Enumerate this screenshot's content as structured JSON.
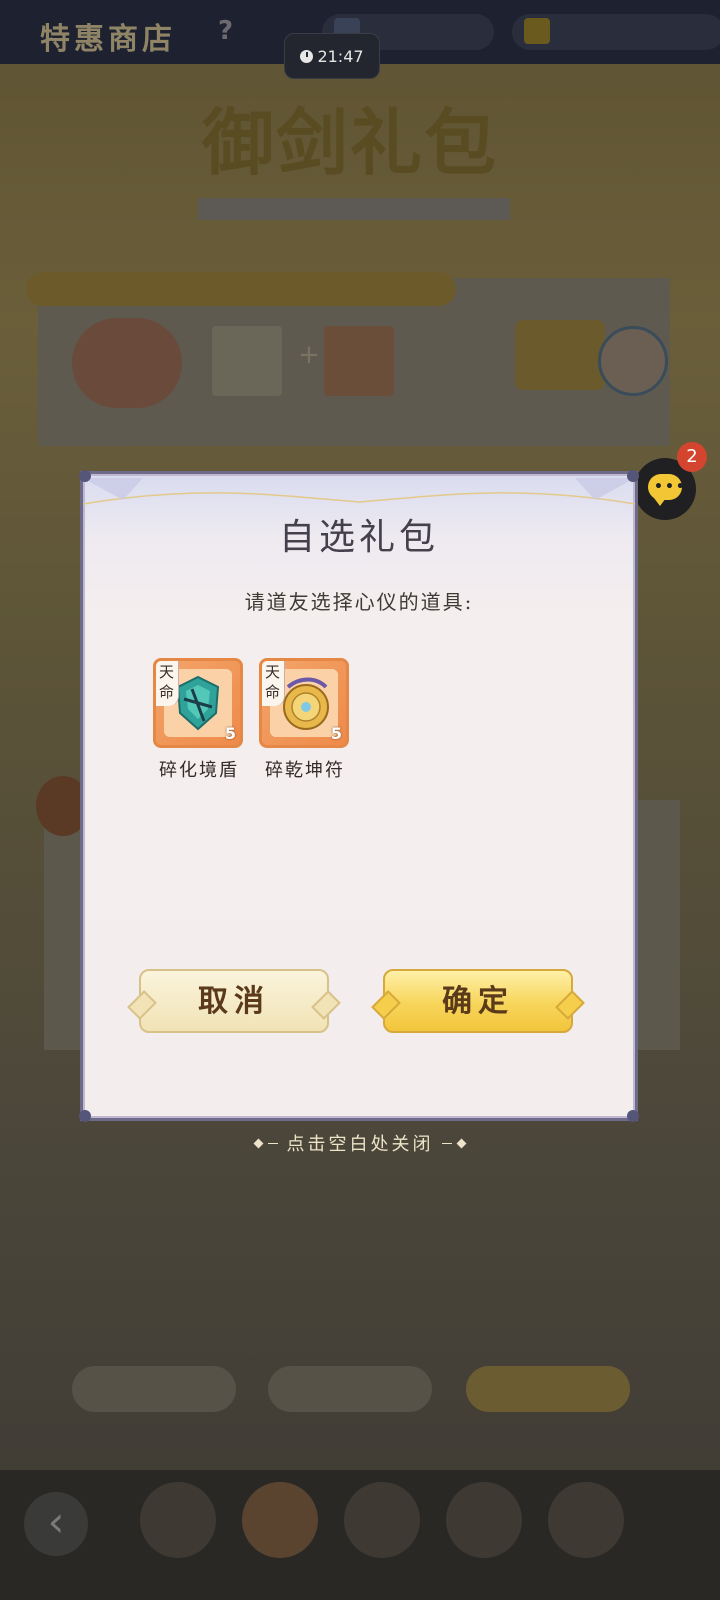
{
  "status_bar": {
    "time": "21:47"
  },
  "modal": {
    "title": "自选礼包",
    "prompt": "请道友选择心仪的道具:",
    "items": [
      {
        "name": "碎化境盾",
        "tag": "天命",
        "stars": "5",
        "icon": "shield-shard-icon"
      },
      {
        "name": "碎乾坤符",
        "tag": "天命",
        "stars": "5",
        "icon": "talisman-shard-icon"
      }
    ],
    "cancel_label": "取消",
    "confirm_label": "确定"
  },
  "close_hint": "点击空白处关闭",
  "chat": {
    "badge_count": "2"
  },
  "colors": {
    "confirm_gold": "#f7d55a",
    "cancel_cream": "#f1e3b6",
    "item_frame_orange": "#ee8a4a",
    "modal_border": "#6d6a8a",
    "badge_red": "#d3452f"
  }
}
